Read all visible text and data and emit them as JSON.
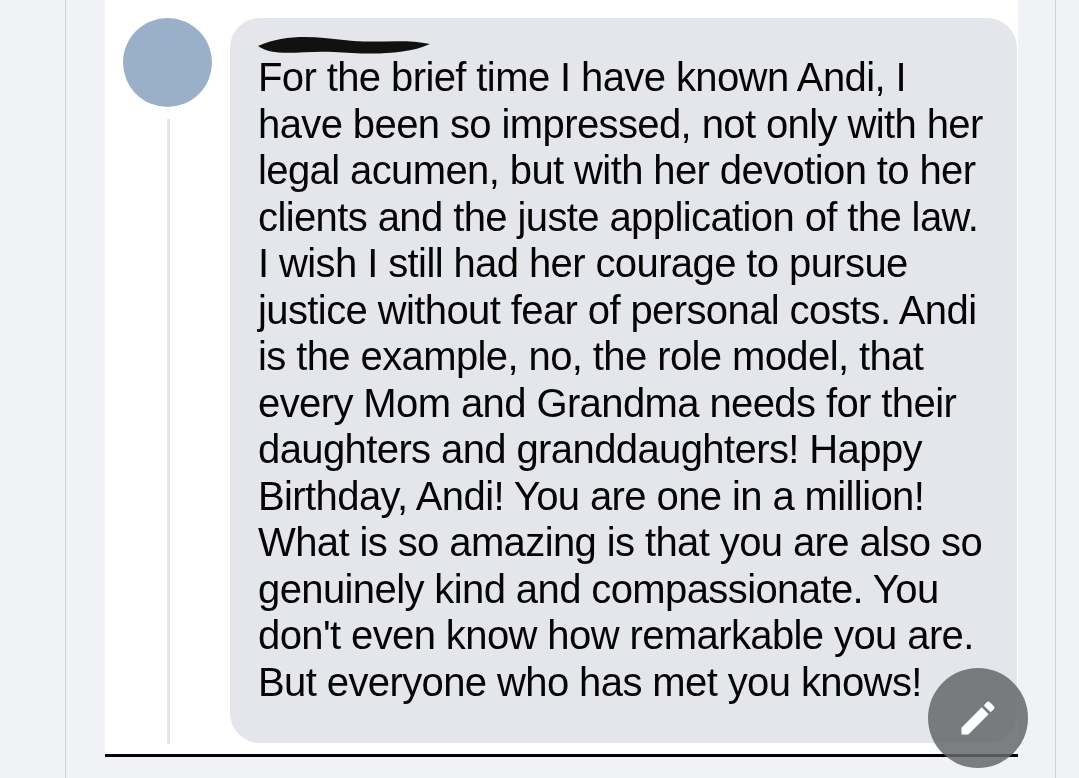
{
  "comment": {
    "author_redacted": true,
    "paragraphs": [
      "For the brief time I have known Andi, I have been so impressed, not only with her legal acumen, but with her devotion to her clients and the juste application of the law. I wish I still had her courage to pursue justice without fear of personal costs. Andi is the example,  no, the role model, that every Mom and Grandma needs for their daughters and granddaughters! Happy Birthday, Andi! You are one in a million!",
      "What is so amazing is that you are also so genuinely kind and compassionate. You don't even know how remarkable you are. But everyone who has met you knows!"
    ]
  }
}
